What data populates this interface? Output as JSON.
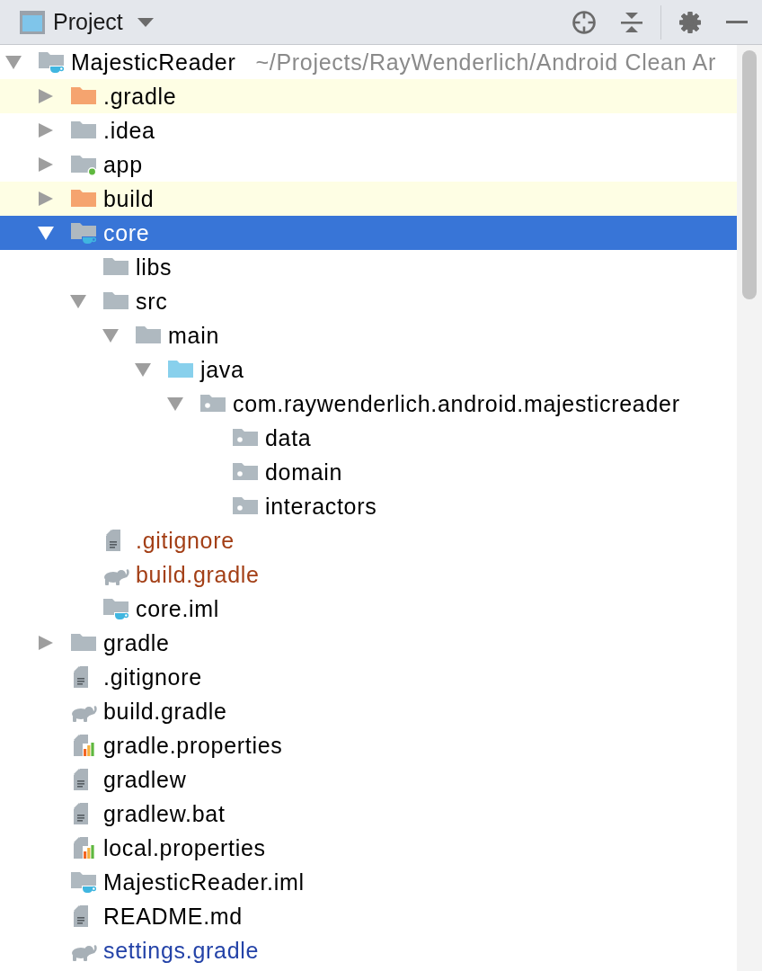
{
  "panel": {
    "title": "Project"
  },
  "tree": [
    {
      "name": "MajesticReader",
      "path": "~/Projects/RayWenderlich/Android Clean Ar",
      "kind": "module",
      "expanded": true,
      "selected": false,
      "highlighted": false,
      "children": [
        {
          "name": ".gradle",
          "kind": "excluded",
          "expanded": false,
          "selected": false,
          "highlighted": true
        },
        {
          "name": ".idea",
          "kind": "folder",
          "expanded": false,
          "selected": false,
          "highlighted": false
        },
        {
          "name": "app",
          "kind": "android",
          "expanded": false,
          "selected": false,
          "highlighted": false
        },
        {
          "name": "build",
          "kind": "excluded",
          "expanded": false,
          "selected": false,
          "highlighted": true
        },
        {
          "name": "core",
          "kind": "module",
          "expanded": true,
          "selected": true,
          "highlighted": false,
          "children": [
            {
              "name": "libs",
              "kind": "folder",
              "selected": false,
              "highlighted": false
            },
            {
              "name": "src",
              "kind": "folder",
              "expanded": true,
              "selected": false,
              "highlighted": false,
              "children": [
                {
                  "name": "main",
                  "kind": "folder",
                  "expanded": true,
                  "selected": false,
                  "highlighted": false,
                  "children": [
                    {
                      "name": "java",
                      "kind": "source",
                      "expanded": true,
                      "selected": false,
                      "highlighted": false,
                      "children": [
                        {
                          "name": "com.raywenderlich.android.majesticreader",
                          "kind": "package",
                          "expanded": true,
                          "selected": false,
                          "highlighted": false,
                          "children": [
                            {
                              "name": "data",
                              "kind": "package",
                              "selected": false,
                              "highlighted": false
                            },
                            {
                              "name": "domain",
                              "kind": "package",
                              "selected": false,
                              "highlighted": false
                            },
                            {
                              "name": "interactors",
                              "kind": "package",
                              "selected": false,
                              "highlighted": false
                            }
                          ]
                        }
                      ]
                    }
                  ]
                }
              ]
            },
            {
              "name": ".gitignore",
              "kind": "text",
              "color": "#a33f16",
              "selected": false,
              "highlighted": false
            },
            {
              "name": "build.gradle",
              "kind": "gradle",
              "color": "#a33f16",
              "selected": false,
              "highlighted": false
            },
            {
              "name": "core.iml",
              "kind": "module",
              "selected": false,
              "highlighted": false
            }
          ]
        },
        {
          "name": "gradle",
          "kind": "folder",
          "expanded": false,
          "selected": false,
          "highlighted": false
        },
        {
          "name": ".gitignore",
          "kind": "text",
          "selected": false,
          "highlighted": false
        },
        {
          "name": "build.gradle",
          "kind": "gradle",
          "selected": false,
          "highlighted": false
        },
        {
          "name": "gradle.properties",
          "kind": "properties",
          "selected": false,
          "highlighted": false
        },
        {
          "name": "gradlew",
          "kind": "text",
          "selected": false,
          "highlighted": false
        },
        {
          "name": "gradlew.bat",
          "kind": "text",
          "selected": false,
          "highlighted": false
        },
        {
          "name": "local.properties",
          "kind": "properties",
          "selected": false,
          "highlighted": false
        },
        {
          "name": "MajesticReader.iml",
          "kind": "module",
          "selected": false,
          "highlighted": false
        },
        {
          "name": "README.md",
          "kind": "text",
          "selected": false,
          "highlighted": false
        },
        {
          "name": "settings.gradle",
          "kind": "gradle",
          "color": "#2443a8",
          "selected": false,
          "highlighted": false
        }
      ]
    }
  ]
}
